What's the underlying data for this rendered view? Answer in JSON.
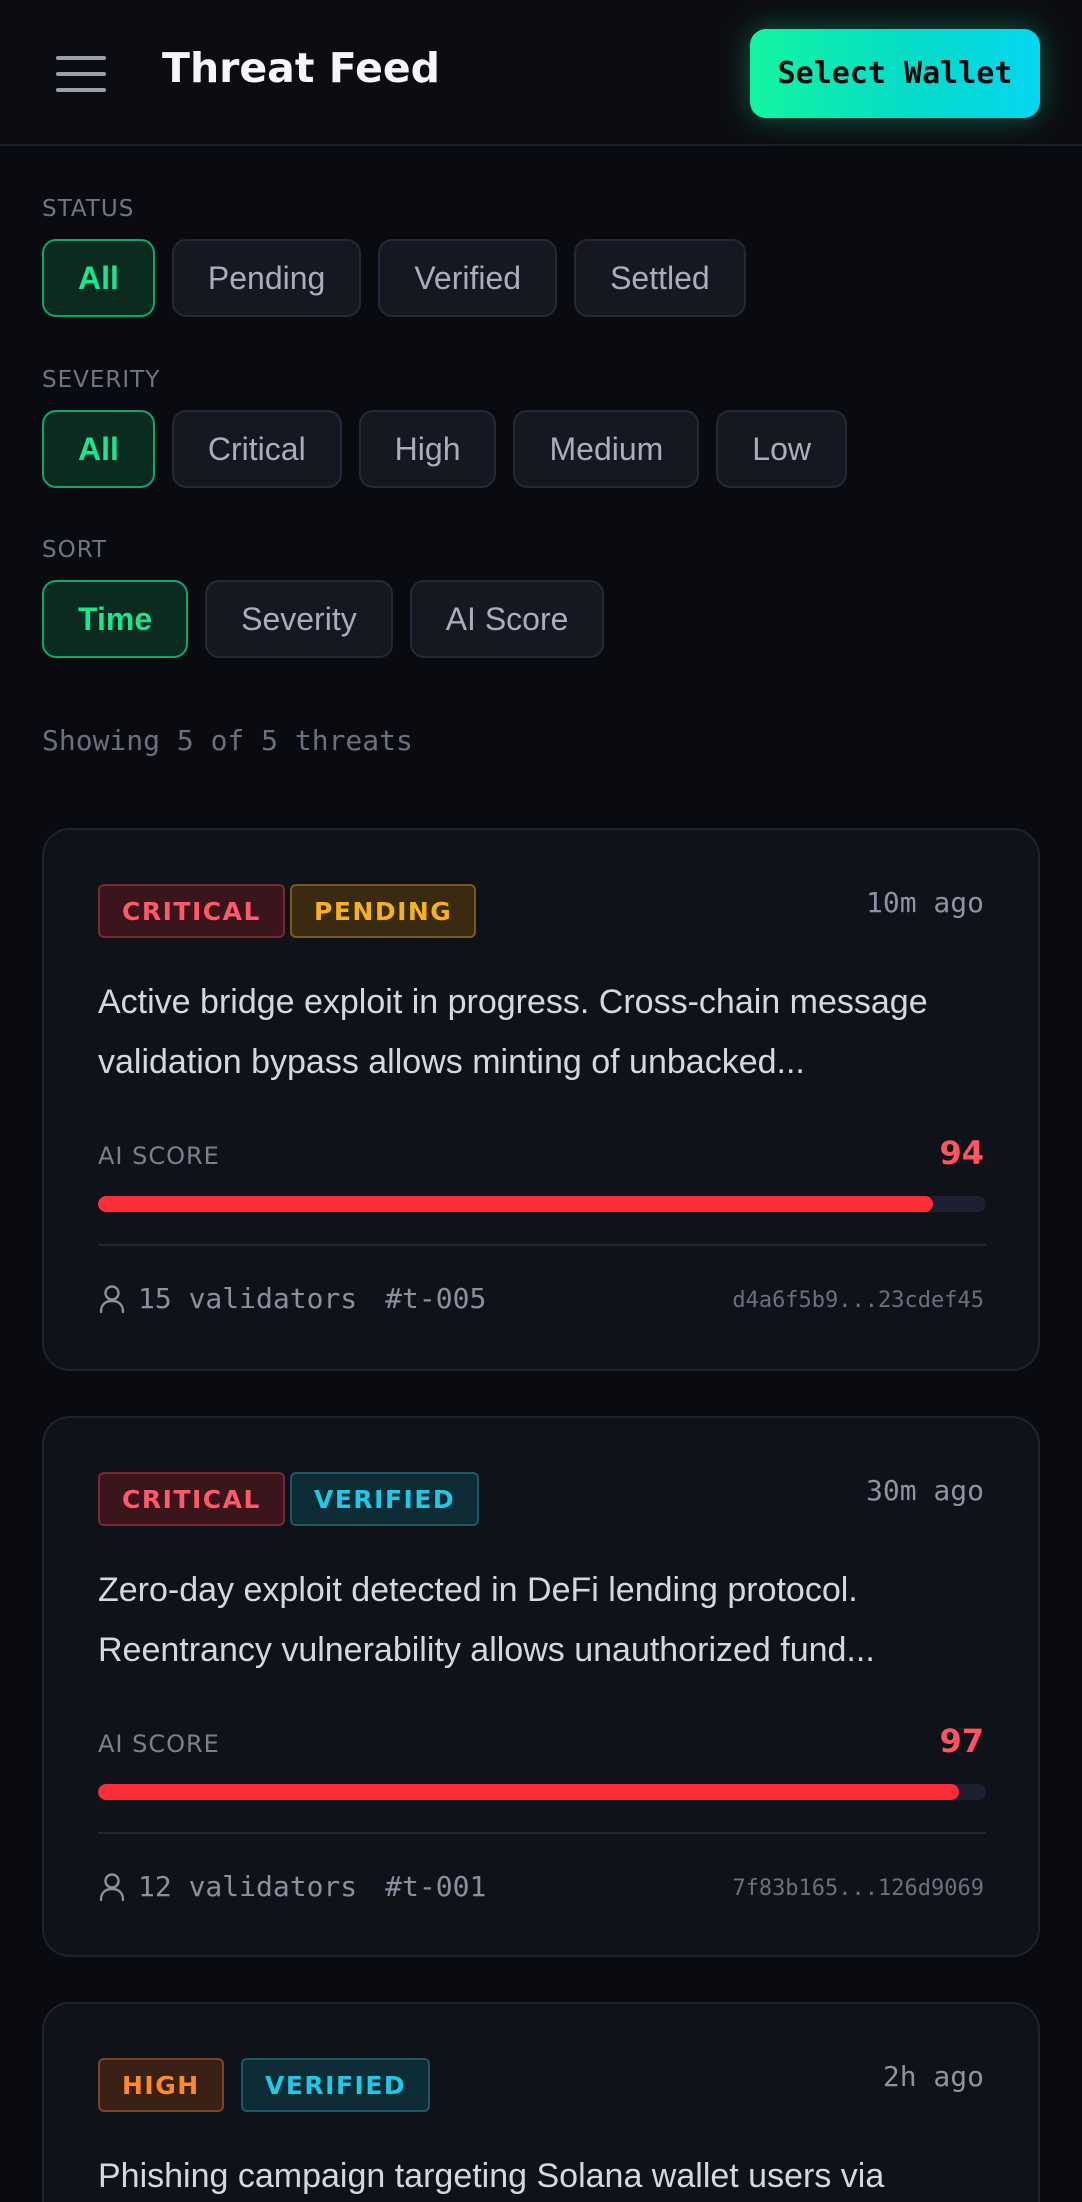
{
  "header": {
    "title": "Threat Feed",
    "wallet_button": "Select Wallet"
  },
  "filters": {
    "status": {
      "label": "STATUS",
      "options": [
        "All",
        "Pending",
        "Verified",
        "Settled"
      ],
      "selected": "All"
    },
    "severity": {
      "label": "SEVERITY",
      "options": [
        "All",
        "Critical",
        "High",
        "Medium",
        "Low"
      ],
      "selected": "All"
    },
    "sort": {
      "label": "SORT",
      "options": [
        "Time",
        "Severity",
        "AI Score"
      ],
      "selected": "Time"
    }
  },
  "summary": "Showing 5 of 5 threats",
  "threats": [
    {
      "severity": "CRITICAL",
      "status": "PENDING",
      "time": "10m ago",
      "description": "Active bridge exploit in progress. Cross-chain message validation bypass allows minting of unbacked...",
      "ai_label": "AI SCORE",
      "ai_score": "94",
      "ai_score_value": 94,
      "validators": "15 validators",
      "id": "#t-005",
      "hash": "d4a6f5b9...23cdef45"
    },
    {
      "severity": "CRITICAL",
      "status": "VERIFIED",
      "time": "30m ago",
      "description": "Zero-day exploit detected in DeFi lending protocol. Reentrancy vulnerability allows unauthorized fund...",
      "ai_label": "AI SCORE",
      "ai_score": "97",
      "ai_score_value": 97,
      "validators": "12 validators",
      "id": "#t-001",
      "hash": "7f83b165...126d9069"
    },
    {
      "severity": "HIGH",
      "status": "VERIFIED",
      "time": "2h ago",
      "description": "Phishing campaign targeting Solana wallet users via"
    }
  ]
}
